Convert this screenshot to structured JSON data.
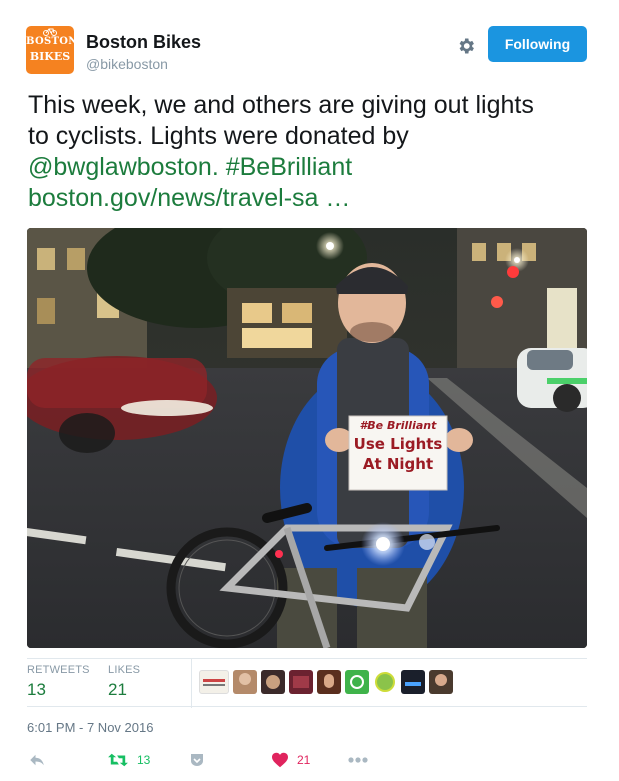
{
  "account": {
    "name": "Boston Bikes",
    "handle": "@bikeboston",
    "avatar_text_top": "BOSTON",
    "avatar_text_bottom": "BIKES",
    "avatar_color": "#f58220"
  },
  "follow_button_label": "Following",
  "tweet": {
    "line1": "This week, we and others are giving out lights",
    "line2": "to cyclists. Lights were donated by",
    "mention": "@bwglawboston.",
    "hashtag": "#BeBrilliant",
    "url": "boston.gov/news/travel-sa …"
  },
  "photo": {
    "sign_line1": "#Be Brilliant",
    "sign_line2": "Use Lights",
    "sign_line3": "At Night"
  },
  "stats": {
    "retweets_label": "RETWEETS",
    "retweets_count": "13",
    "likes_label": "LIKES",
    "likes_count": "21"
  },
  "timestamp": "6:01 PM - 7 Nov 2016",
  "actions": {
    "retweet_count": "13",
    "like_count": "21"
  },
  "icons": [
    "gear-icon",
    "reply-icon",
    "retweet-icon",
    "save-icon",
    "heart-icon",
    "more-icon"
  ],
  "colors": {
    "link_green": "#1c7c3d",
    "follow_blue": "#1b95e0",
    "like_red": "#e0245e",
    "retweet_green": "#17bf63",
    "muted_gray": "#8899a6"
  }
}
